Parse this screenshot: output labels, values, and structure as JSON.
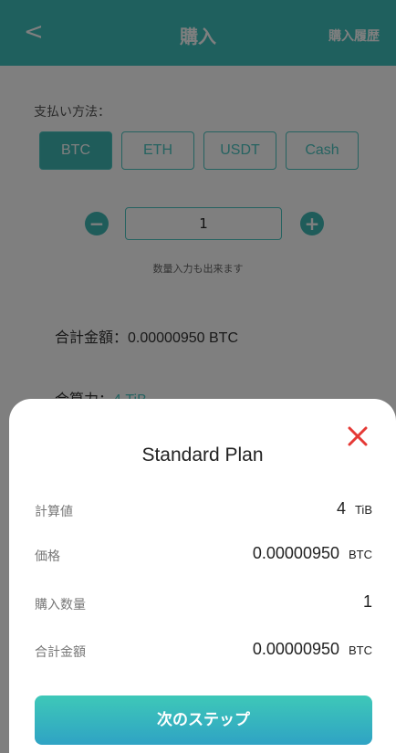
{
  "navbar": {
    "back_icon": "chevron-left-icon",
    "back_glyph": "<",
    "title": "購入",
    "history_label": "購入履歴"
  },
  "payment": {
    "label": "支払い方法：",
    "options": [
      "BTC",
      "ETH",
      "USDT",
      "Cash"
    ],
    "selected": "BTC"
  },
  "quantity": {
    "minus_glyph": "−",
    "plus_glyph": "+",
    "value": "1",
    "hint": "数量入力も出来ます"
  },
  "summary": {
    "total_label": "合計金額：",
    "total_value": "0.00000950 BTC",
    "calc_label": "合算力：",
    "calc_value": "4 TiB"
  },
  "sheet": {
    "title": "Standard Plan",
    "close_icon": "close-x-icon",
    "rows": [
      {
        "label": "計算値",
        "value": "4",
        "unit": "TiB"
      },
      {
        "label": "価格",
        "value": "0.00000950",
        "unit": "BTC"
      },
      {
        "label": "購入数量",
        "value": "1",
        "unit": ""
      },
      {
        "label": "合計金額",
        "value": "0.00000950",
        "unit": "BTC"
      }
    ],
    "next_label": "次のステップ"
  },
  "colors": {
    "accent": "#3fc0bd",
    "close": "#e53935"
  }
}
